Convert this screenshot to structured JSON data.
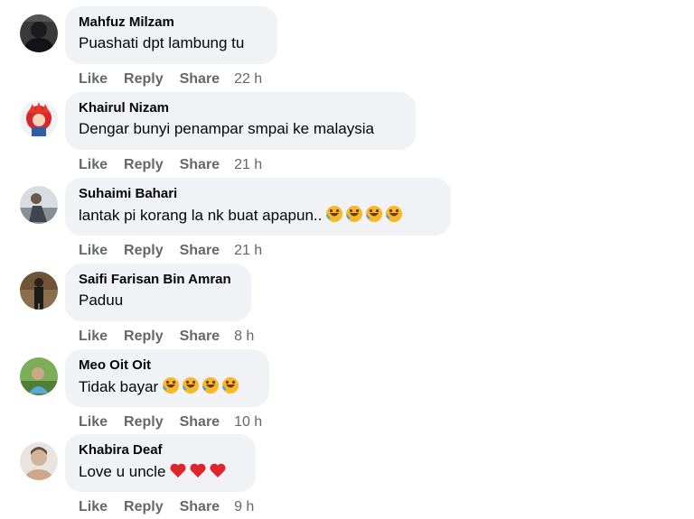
{
  "actions": {
    "like": "Like",
    "reply": "Reply",
    "share": "Share"
  },
  "comments": [
    {
      "author": "Mahfuz Milzam",
      "text": "Puashati dpt lambung tu",
      "time": "22 h",
      "emojis": []
    },
    {
      "author": "Khairul Nizam",
      "text": "Dengar bunyi penampar smpai ke malaysia",
      "time": "21 h",
      "emojis": []
    },
    {
      "author": "Suhaimi Bahari",
      "text": "lantak pi korang la nk buat apapun..",
      "time": "21 h",
      "emojis": [
        "rolling-on-floor-laughing-emoji",
        "rolling-on-floor-laughing-emoji",
        "rolling-on-floor-laughing-emoji",
        "rolling-on-floor-laughing-emoji"
      ]
    },
    {
      "author": "Saifi Farisan Bin Amran",
      "text": "Paduu",
      "time": "8 h",
      "emojis": []
    },
    {
      "author": "Meo Oit Oit",
      "text": "Tidak bayar",
      "time": "10 h",
      "emojis": [
        "rolling-on-floor-laughing-emoji",
        "rolling-on-floor-laughing-emoji",
        "rolling-on-floor-laughing-emoji",
        "rolling-on-floor-laughing-emoji"
      ]
    },
    {
      "author": "Khabira Deaf",
      "text": "Love u uncle",
      "time": "9 h",
      "emojis": [
        "red-heart-emoji",
        "red-heart-emoji",
        "red-heart-emoji"
      ]
    }
  ],
  "colors": {
    "bubble": "#f0f2f5",
    "action_text": "#65676b",
    "primary_text": "#050505"
  }
}
